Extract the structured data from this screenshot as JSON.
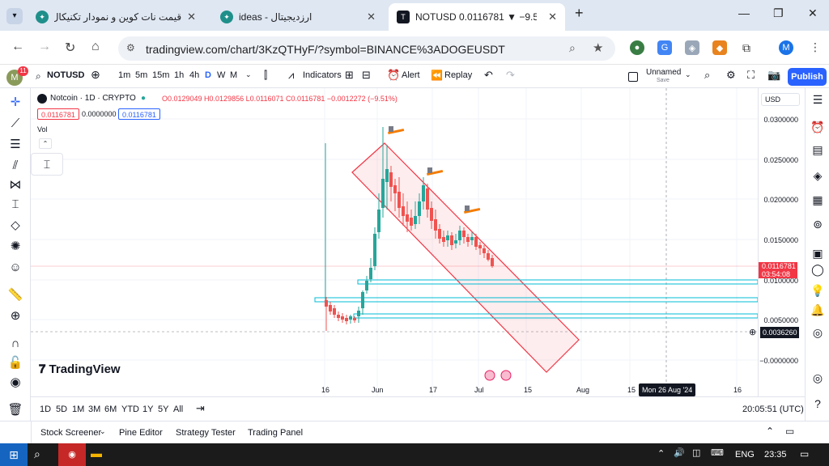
{
  "browser": {
    "tabs": [
      {
        "title": "قیمت نات کوین و نمودار تکنیکال"
      },
      {
        "title": "ideas - ارزدیجیتال"
      },
      {
        "title": "NOTUSD 0.0116781 ▼ −9.51%"
      }
    ],
    "url": "tradingview.com/chart/3KzQTHyF/?symbol=BINANCE%3ADOGEUSDT",
    "profile_letter": "M"
  },
  "toolbar": {
    "avatar_badge": "11",
    "symbol": "NOTUSD",
    "intervals": [
      "1m",
      "5m",
      "15m",
      "1h",
      "4h",
      "D",
      "W",
      "M"
    ],
    "active_interval": "D",
    "indicators": "Indicators",
    "alert": "Alert",
    "replay": "Replay",
    "unnamed": "Unnamed",
    "save": "Save",
    "publish": "Publish"
  },
  "legend": {
    "title": "Notcoin · 1D · CRYPTO",
    "ohlc": "O0.0129049 H0.0129856 L0.0116071 C0.0116781 −0.0012272 (−9.51%)",
    "bid": "0.0116781",
    "spread": "0.0000000",
    "ask": "0.0116781",
    "vol": "Vol"
  },
  "scale": {
    "currency": "USD",
    "labels": [
      "0.0300000",
      "0.0250000",
      "0.0200000",
      "0.0150000",
      "0.0100000",
      "0.0050000",
      "−0.0000000"
    ],
    "last_price": "0.0116781",
    "countdown": "03:54:08",
    "crosshair_price": "0.0036260"
  },
  "time_axis": {
    "labels": [
      "16",
      "Jun",
      "17",
      "Jul",
      "15",
      "Aug",
      "15",
      "16"
    ],
    "crosshair_date": "Mon 26 Aug '24"
  },
  "watermark": "TradingView",
  "bottom": {
    "ranges": [
      "1D",
      "5D",
      "1M",
      "3M",
      "6M",
      "YTD",
      "1Y",
      "5Y",
      "All"
    ],
    "clock": "20:05:51 (UTC)"
  },
  "footer": {
    "tabs": [
      "Stock Screener",
      "Pine Editor",
      "Strategy Tester",
      "Trading Panel"
    ]
  },
  "taskbar": {
    "lang": "ENG",
    "time": "23:35"
  },
  "colors": {
    "up": "#26a69a",
    "down": "#ef5350",
    "channel": "#f23645",
    "zone": "#00bcd4",
    "accent": "#2962ff"
  }
}
